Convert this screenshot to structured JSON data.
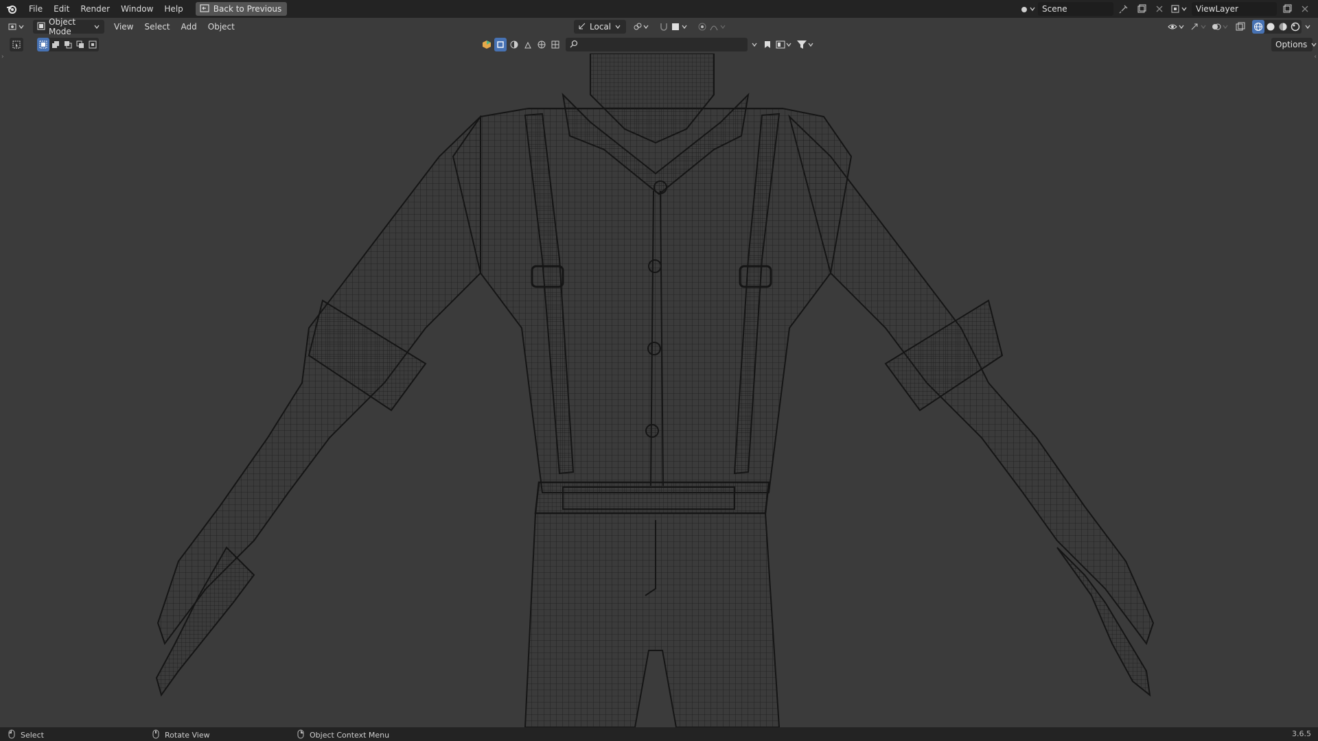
{
  "menubar": {
    "items": [
      "File",
      "Edit",
      "Render",
      "Window",
      "Help"
    ],
    "back_button": "Back to Previous"
  },
  "scene": {
    "label": "Scene"
  },
  "view_layer": {
    "label": "ViewLayer"
  },
  "viewport_header": {
    "mode": "Object Mode",
    "menus": [
      "View",
      "Select",
      "Add",
      "Object"
    ],
    "transform_orientation": "Local",
    "options_label": "Options"
  },
  "search": {
    "placeholder": ""
  },
  "statusbar": {
    "select": "Select",
    "rotate": "Rotate View",
    "context": "Object Context Menu",
    "version": "3.6.5"
  },
  "colors": {
    "accent": "#4772b3",
    "viewport_bg": "#3b3b3b",
    "wire": "#1a1a1a"
  }
}
